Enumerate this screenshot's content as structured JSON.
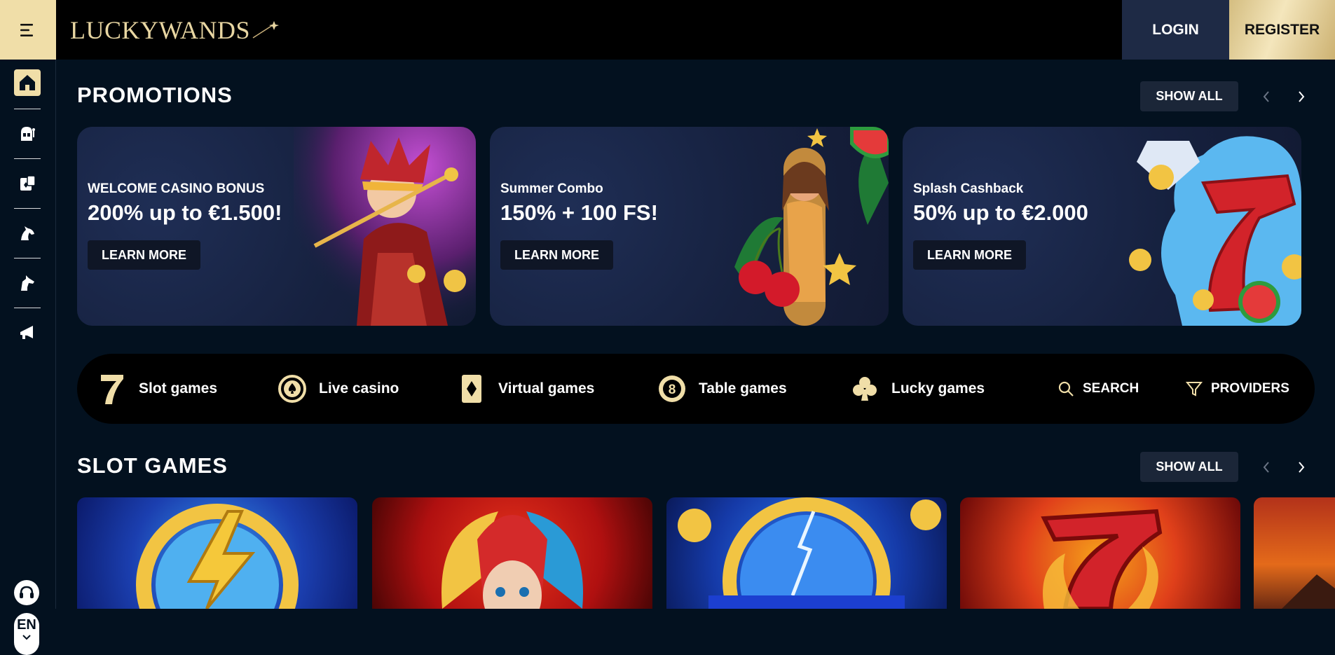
{
  "header": {
    "logo_text": "LUCKYWANDS",
    "login_label": "LOGIN",
    "register_label": "REGISTER"
  },
  "sidebar": {
    "items": [
      {
        "icon": "home-icon",
        "active": true
      },
      {
        "icon": "slot-machine-icon",
        "active": false
      },
      {
        "icon": "live-cards-icon",
        "active": false
      },
      {
        "icon": "horse-icon",
        "active": false
      },
      {
        "icon": "greyhound-icon",
        "active": false
      },
      {
        "icon": "megaphone-icon",
        "active": false
      }
    ],
    "support_icon": "headset-icon",
    "language": "EN"
  },
  "promotions": {
    "title": "PROMOTIONS",
    "show_all_label": "SHOW ALL",
    "cards": [
      {
        "kicker": "WELCOME CASINO BONUS",
        "headline": "200% up to €1.500!",
        "button": "LEARN MORE"
      },
      {
        "kicker": "Summer Combo",
        "headline": "150% + 100 FS!",
        "button": "LEARN MORE"
      },
      {
        "kicker": "Splash Cashback",
        "headline": "50% up to €2.000",
        "button": "LEARN MORE"
      }
    ]
  },
  "categories": [
    {
      "label": "Slot games",
      "icon": "seven-icon"
    },
    {
      "label": "Live casino",
      "icon": "chip-spade-icon"
    },
    {
      "label": "Virtual games",
      "icon": "card-diamond-icon"
    },
    {
      "label": "Table games",
      "icon": "eight-ball-icon"
    },
    {
      "label": "Lucky games",
      "icon": "club-icon"
    },
    {
      "label": "SEARCH",
      "icon": "search-icon"
    },
    {
      "label": "PROVIDERS",
      "icon": "filter-icon"
    }
  ],
  "slot_games": {
    "title": "SLOT GAMES",
    "show_all_label": "SHOW ALL"
  },
  "colors": {
    "background": "#03111f",
    "accent_gold": "#f0dea8",
    "login_bg": "#1e2a45",
    "card_bg": "#16213f"
  }
}
